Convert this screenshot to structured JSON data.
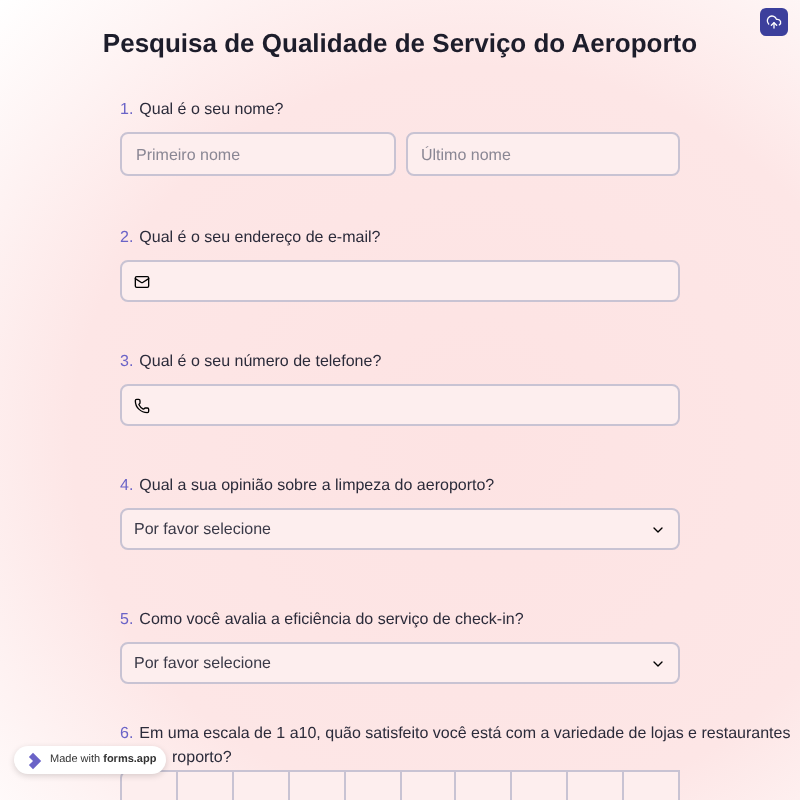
{
  "title": "Pesquisa de Qualidade de Serviço do Aeroporto",
  "questions": [
    {
      "number": "1.",
      "label": "Qual é o seu nome?",
      "kind": "name",
      "placeholders": [
        "Primeiro nome",
        "Último nome"
      ]
    },
    {
      "number": "2.",
      "label": "Qual é o seu endereço de e-mail?",
      "kind": "email"
    },
    {
      "number": "3.",
      "label": "Qual é o seu número de telefone?",
      "kind": "phone"
    },
    {
      "number": "4.",
      "label": "Qual a sua opinião sobre a limpeza do aeroporto?",
      "kind": "select",
      "placeholder": "Por favor selecione"
    },
    {
      "number": "5.",
      "label": "Como você avalia a eficiência do serviço de check-in?",
      "kind": "select",
      "placeholder": "Por favor selecione"
    },
    {
      "number": "6.",
      "label": "Em uma escala de 1 a10, quão satisfeito você está com a variedade de lojas e restaurantes",
      "label_end": "roporto?",
      "kind": "scale",
      "options": [
        {
          "selected": false
        },
        {
          "selected": false
        },
        {
          "selected": false
        },
        {
          "selected": false
        },
        {
          "selected": false
        },
        {
          "selected": false
        },
        {
          "selected": false
        },
        {
          "selected": false
        },
        {
          "selected": false
        },
        {
          "selected": false
        }
      ]
    }
  ],
  "badge": {
    "prefix": "Made with",
    "brand": "forms.app"
  }
}
